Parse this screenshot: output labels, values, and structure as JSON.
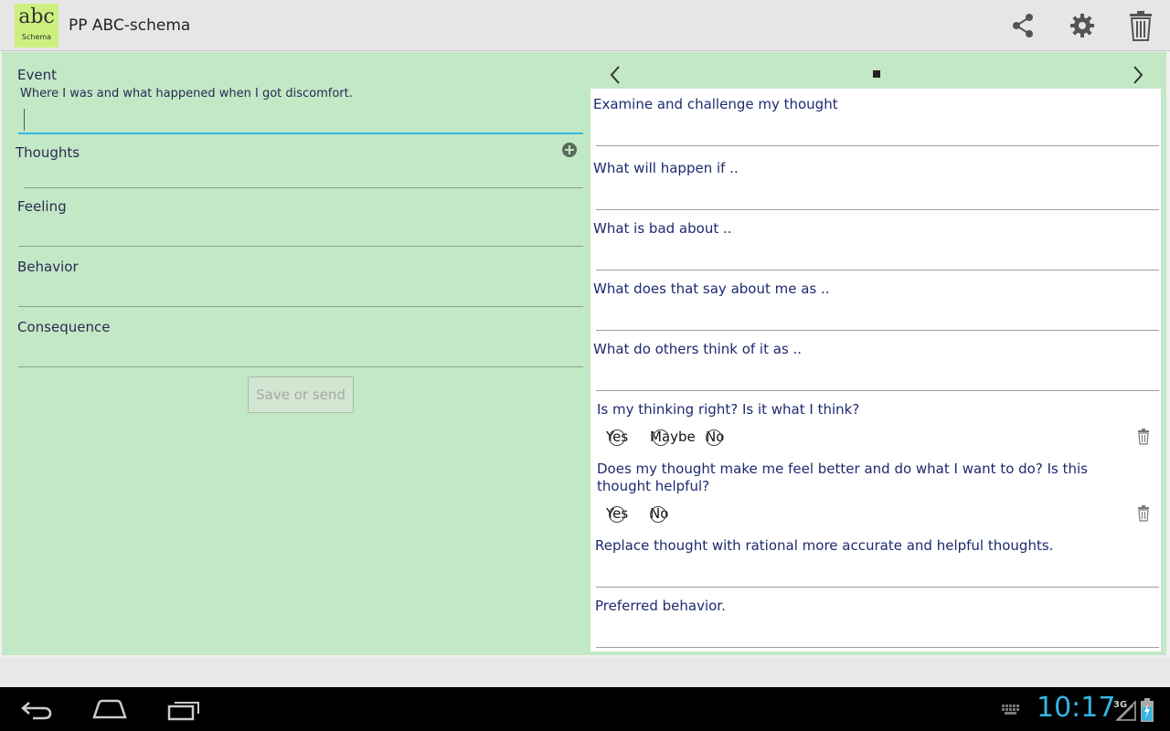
{
  "app": {
    "logo_text": "abc",
    "logo_sub": "Schema",
    "title": "PP ABC-schema"
  },
  "actions": {
    "share_icon": "share-icon",
    "settings_icon": "gear-icon",
    "delete_icon": "trash-icon"
  },
  "form": {
    "event_label": "Event",
    "event_hint": "Where I was and what happened when I got discomfort.",
    "event_value": "",
    "thoughts_label": "Thoughts",
    "feeling_label": "Feeling",
    "behavior_label": "Behavior",
    "consequence_label": "Consequence",
    "save_label": "Save or send"
  },
  "challenge": {
    "q1": "Examine and challenge my thought",
    "q2": "What will happen if ..",
    "q3": "What is bad about ..",
    "q4": "What does that say about me as ..",
    "q5": "What do others think of it as ..",
    "q6": "Is my thinking right? Is it what I think?",
    "q6_options": [
      "Yes",
      "Maybe",
      "No"
    ],
    "q7": "Does my thought make me feel better and do what I want to do? Is this thought helpful?",
    "q7_options": [
      "Yes",
      "No"
    ],
    "q8": "Replace thought with rational more accurate and helpful thoughts.",
    "q9": "Preferred behavior."
  },
  "system": {
    "time": "10:17",
    "network": "3G"
  },
  "colors": {
    "panel_green": "#c3e8c5",
    "accent_blue": "#33b5e5",
    "question_text": "#1e2a6e"
  }
}
